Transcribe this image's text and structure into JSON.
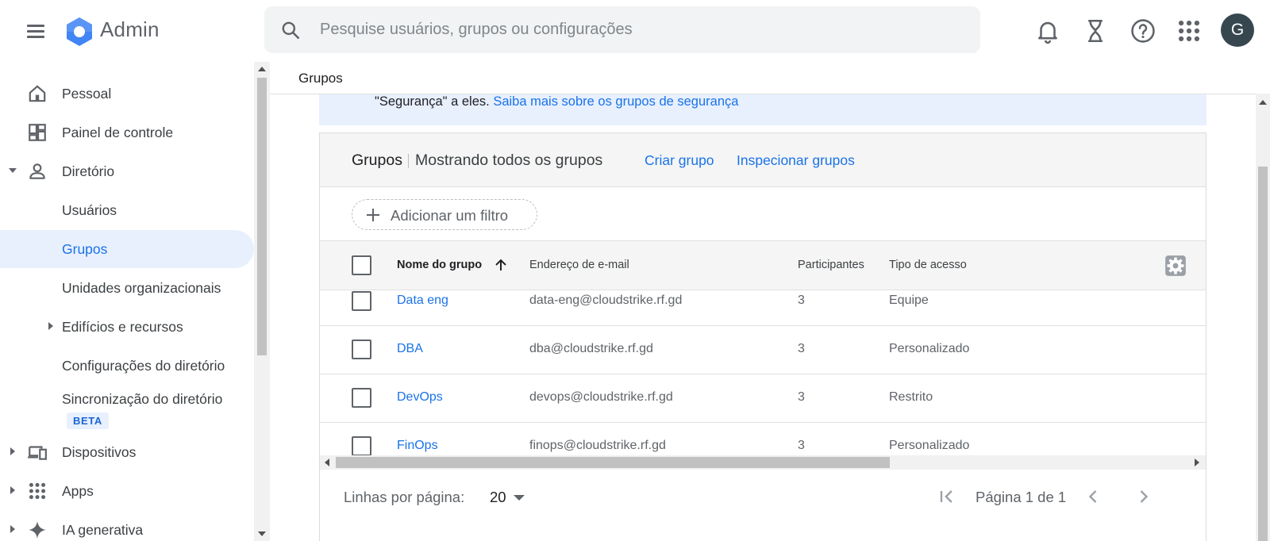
{
  "app": {
    "name": "Admin"
  },
  "search": {
    "placeholder": "Pesquise usuários, grupos ou configurações"
  },
  "account": {
    "avatar_letter": "G"
  },
  "sidebar": {
    "items": [
      {
        "label": "Pessoal"
      },
      {
        "label": "Painel de controle"
      },
      {
        "label": "Diretório"
      },
      {
        "label": "Usuários"
      },
      {
        "label": "Grupos"
      },
      {
        "label": "Unidades organizacionais"
      },
      {
        "label": "Edifícios e recursos"
      },
      {
        "label": "Configurações do diretório"
      },
      {
        "label": "Sincronização do diretório"
      },
      {
        "label": "Dispositivos"
      },
      {
        "label": "Apps"
      },
      {
        "label": "IA generativa"
      }
    ],
    "beta_badge": "BETA"
  },
  "page": {
    "title": "Grupos"
  },
  "info": {
    "text": "\"Segurança\" a eles.",
    "link": "Saiba mais sobre os grupos de segurança"
  },
  "card": {
    "title": "Grupos",
    "subtitle": "Mostrando todos os grupos",
    "create_link": "Criar grupo",
    "inspect_link": "Inspecionar grupos",
    "add_filter": "Adicionar um filtro"
  },
  "table": {
    "columns": [
      "Nome do grupo",
      "Endereço de e-mail",
      "Participantes",
      "Tipo de acesso"
    ],
    "rows": [
      {
        "name": "Data eng",
        "email": "data-eng@cloudstrike.rf.gd",
        "members": "3",
        "access": "Equipe"
      },
      {
        "name": "DBA",
        "email": "dba@cloudstrike.rf.gd",
        "members": "3",
        "access": "Personalizado"
      },
      {
        "name": "DevOps",
        "email": "devops@cloudstrike.rf.gd",
        "members": "3",
        "access": "Restrito"
      },
      {
        "name": "FinOps",
        "email": "finops@cloudstrike.rf.gd",
        "members": "3",
        "access": "Personalizado"
      }
    ]
  },
  "pagination": {
    "rows_label": "Linhas por página:",
    "rows_value": "20",
    "page_info": "Página 1 de 1"
  },
  "colors": {
    "accent": "#1a73e8",
    "selected_bg": "#e8f0fe",
    "avatar_bg": "#37474f"
  },
  "icons": [
    "menu-icon",
    "admin-logo",
    "search-icon",
    "bell-icon",
    "hourglass-icon",
    "help-icon",
    "apps-grid-icon",
    "home-icon",
    "dashboard-icon",
    "person-icon",
    "devices-icon",
    "apps-icon",
    "sparkle-icon",
    "gear-icon",
    "arrow-up-icon",
    "plus-icon",
    "first-page-icon",
    "prev-page-icon",
    "next-page-icon"
  ]
}
